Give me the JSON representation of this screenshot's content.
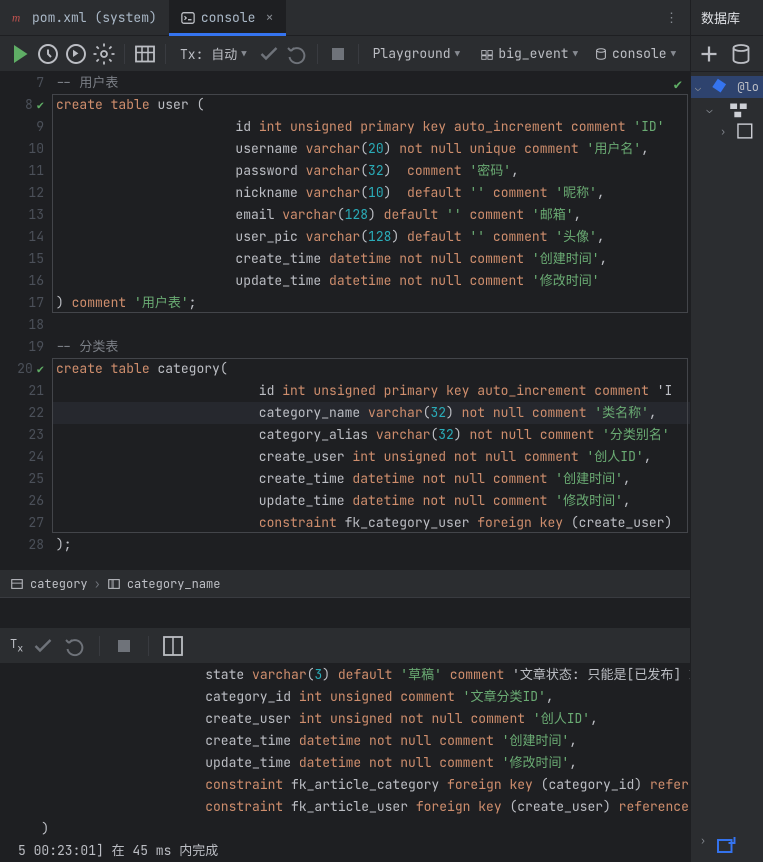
{
  "tabs": {
    "file_tab": "pom.xml (system)",
    "console_tab": "console"
  },
  "toolbar": {
    "tx_label": "Tx: 自动",
    "playground": "Playground",
    "datasource": "big_event",
    "console": "console"
  },
  "right_panel": {
    "header": "数据库",
    "node_root": "@lo"
  },
  "gutter": [
    "7",
    "8",
    "9",
    "10",
    "11",
    "12",
    "13",
    "14",
    "15",
    "16",
    "17",
    "18",
    "19",
    "20",
    "21",
    "22",
    "23",
    "24",
    "25",
    "26",
    "27",
    "28"
  ],
  "code": [
    {
      "t": "cmt",
      "c": "-- 用户表"
    },
    {
      "t": "sql",
      "c": "create table user ("
    },
    {
      "t": "sql",
      "c": "                       id int unsigned primary key auto_increment comment 'ID'"
    },
    {
      "t": "sql",
      "c": "                       username varchar(20) not null unique comment '用户名',"
    },
    {
      "t": "sql",
      "c": "                       password varchar(32)  comment '密码',"
    },
    {
      "t": "sql",
      "c": "                       nickname varchar(10)  default '' comment '昵称',"
    },
    {
      "t": "sql",
      "c": "                       email varchar(128) default '' comment '邮箱',"
    },
    {
      "t": "sql",
      "c": "                       user_pic varchar(128) default '' comment '头像',"
    },
    {
      "t": "sql",
      "c": "                       create_time datetime not null comment '创建时间',"
    },
    {
      "t": "sql",
      "c": "                       update_time datetime not null comment '修改时间'"
    },
    {
      "t": "sql",
      "c": ") comment '用户表';"
    },
    {
      "t": "sql",
      "c": ""
    },
    {
      "t": "cmt",
      "c": "-- 分类表"
    },
    {
      "t": "sql",
      "c": "create table category("
    },
    {
      "t": "sql",
      "c": "                          id int unsigned primary key auto_increment comment 'I"
    },
    {
      "t": "sql",
      "c": "                          category_name varchar(32) not null comment '类名称',"
    },
    {
      "t": "sql",
      "c": "                          category_alias varchar(32) not null comment '分类别名'"
    },
    {
      "t": "sql",
      "c": "                          create_user int unsigned not null comment '创人ID',"
    },
    {
      "t": "sql",
      "c": "                          create_time datetime not null comment '创建时间',"
    },
    {
      "t": "sql",
      "c": "                          update_time datetime not null comment '修改时间',"
    },
    {
      "t": "sql",
      "c": "                          constraint fk_category_user foreign key (create_user)"
    },
    {
      "t": "sql",
      "c": ");"
    }
  ],
  "breadcrumb": {
    "item1": "category",
    "item2": "category_name"
  },
  "console": [
    "                        state varchar(3) default '草稿' comment '文章状态: 只能是[已发布] 或者 [",
    "                        category_id int unsigned comment '文章分类ID',",
    "                        create_user int unsigned not null comment '创人ID',",
    "                        create_time datetime not null comment '创建时间',",
    "                        update_time datetime not null comment '修改时间',",
    "                        constraint fk_article_category foreign key (category_id) references ",
    "                        constraint fk_article_user foreign key (create_user) references use",
    "   )",
    "5 00:23:01] 在 45 ms 内完成"
  ]
}
